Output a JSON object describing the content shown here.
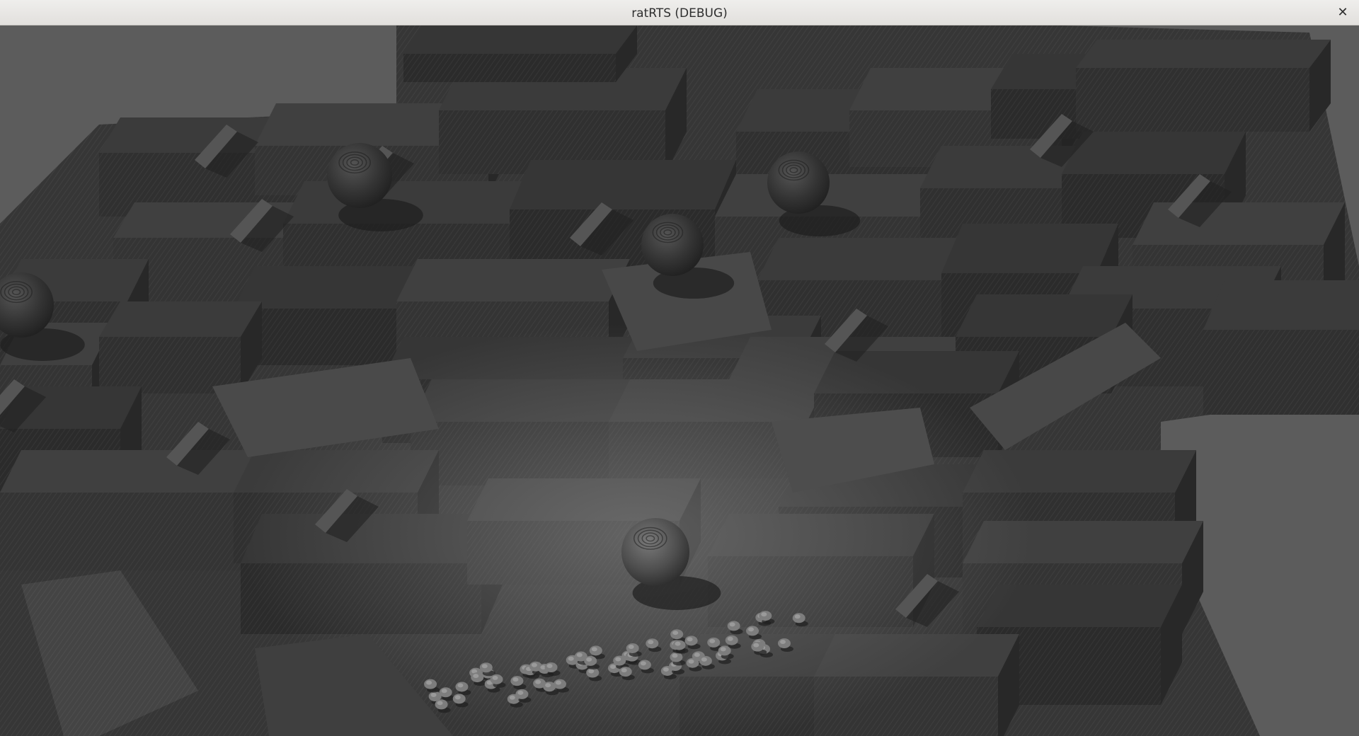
{
  "window": {
    "title": "ratRTS (DEBUG)",
    "close_glyph": "✕",
    "close_icon": "close-icon"
  },
  "scene": {
    "description_kind": "3d-viewport",
    "background_color": "#5c5c5c",
    "block_color": "#3a3a3a",
    "lit_color": "#5e5e5e",
    "shadow_color": "#2a2a2a",
    "unit_color": "#7a7a7a",
    "orb_count": 5,
    "unit_count": 60
  }
}
